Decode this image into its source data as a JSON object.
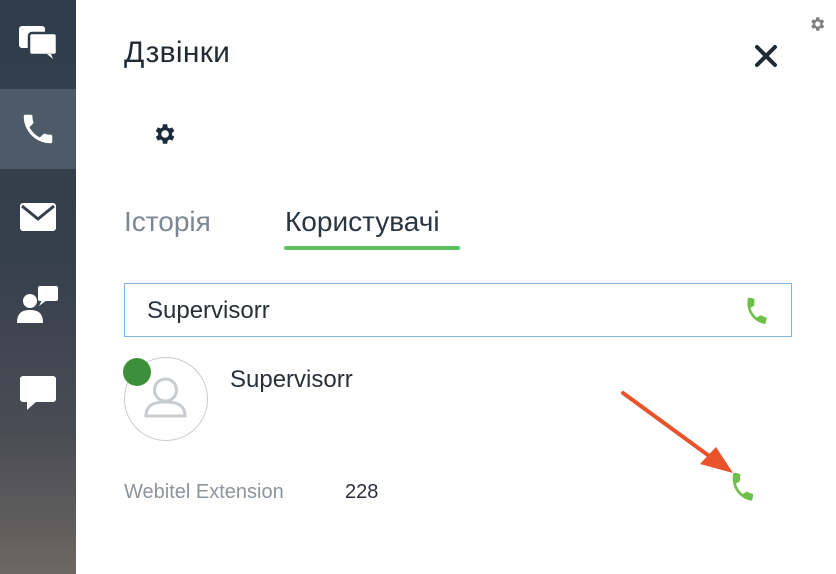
{
  "app": {
    "title": "Дзвінки"
  },
  "nav_rail": {
    "items": [
      {
        "icon": "chats-icon",
        "active": false
      },
      {
        "icon": "phone-icon",
        "active": true
      },
      {
        "icon": "mail-icon",
        "active": false
      },
      {
        "icon": "contacts-chat-icon",
        "active": false
      },
      {
        "icon": "message-icon",
        "active": false
      }
    ]
  },
  "tabs": [
    {
      "label": "Історія",
      "active": false
    },
    {
      "label": "Користувачі",
      "active": true
    }
  ],
  "search": {
    "value": "Supervisorr"
  },
  "user": {
    "name": "Supervisorr",
    "status": "online",
    "extension_label": "Webitel Extension",
    "extension": "228"
  },
  "colors": {
    "rail": "#36404c",
    "active_tab_underline": "#5cc05c",
    "call_green": "#6cc04a",
    "status_online": "#3d8f3b",
    "search_border": "#7fb3e2",
    "annotation_arrow": "#e8532b"
  }
}
